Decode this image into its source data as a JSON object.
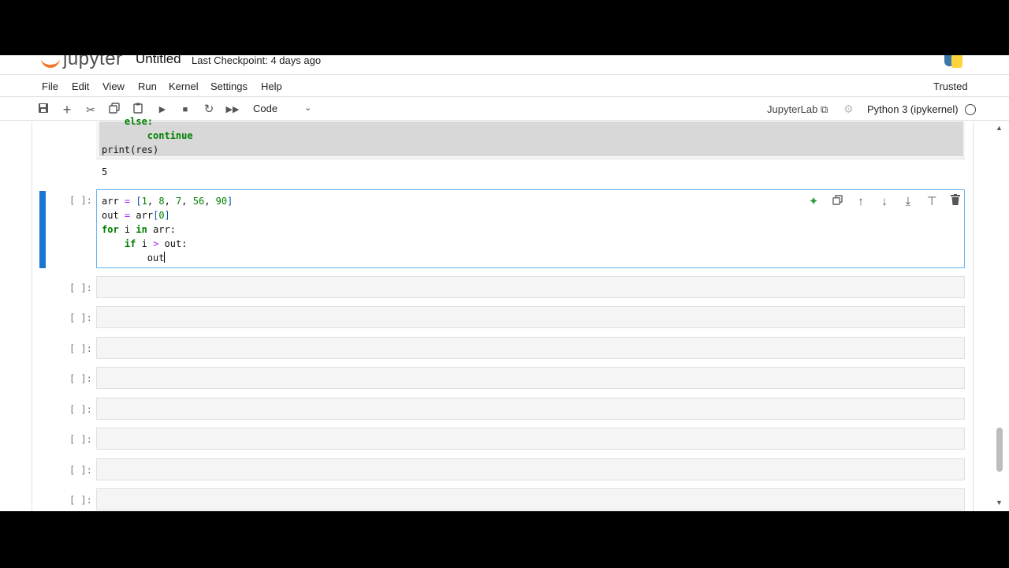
{
  "header": {
    "logo_text": "jupyter",
    "notebook_title": "Untitled",
    "checkpoint": "Last Checkpoint: 4 days ago"
  },
  "menu": {
    "items": [
      "File",
      "Edit",
      "View",
      "Run",
      "Kernel",
      "Settings",
      "Help"
    ],
    "trusted": "Trusted"
  },
  "toolbar": {
    "cell_type": "Code",
    "jupyterlab_link": "JupyterLab",
    "kernel_name": "Python 3 (ipykernel)"
  },
  "previous_cell": {
    "code_lines": [
      "    else:",
      "        continue",
      "print(res)"
    ],
    "output": "5"
  },
  "active_cell": {
    "prompt": "[ ]:",
    "code_lines": [
      "arr = [1, 8, 7, 56, 90]",
      "out = arr[0]",
      "for i in arr:",
      "    if i > out:",
      "        out"
    ]
  },
  "empty_cells": {
    "prompt": "[ ]:",
    "count": 8
  },
  "icons": {
    "toolbar": [
      "save-icon",
      "add-cell-icon",
      "cut-icon",
      "copy-icon",
      "paste-icon",
      "run-icon",
      "stop-icon",
      "restart-icon",
      "run-all-icon"
    ],
    "cell_toolbar": [
      "ai-sparkle-icon",
      "duplicate-icon",
      "move-up-icon",
      "move-down-icon",
      "insert-below-icon",
      "insert-above-icon",
      "delete-icon"
    ]
  },
  "colors": {
    "active_indicator": "#1976d2",
    "logo_orange": "#f37726",
    "keyword_green": "#008000",
    "ai_icon_green": "#2e9d3b"
  }
}
